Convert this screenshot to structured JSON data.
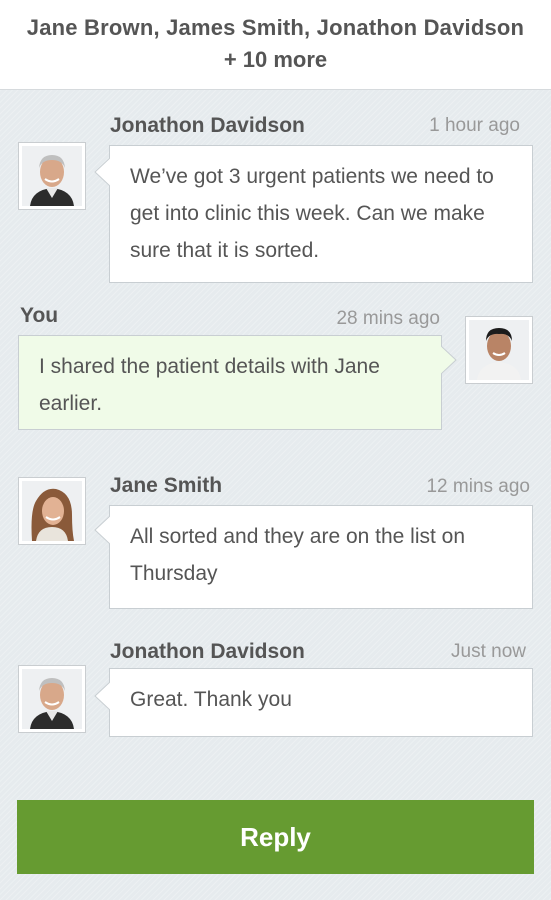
{
  "header": {
    "participants": "Jane Brown, James Smith, Jonathon Davidson",
    "more": "+ 10 more"
  },
  "messages": [
    {
      "sender": "Jonathon Davidson",
      "time": "1 hour ago",
      "text": "We’ve got 3 urgent patients we need to get into clinic this week.  Can we make sure that it is sorted.",
      "avatar": "older-man-avatar"
    },
    {
      "sender": "You",
      "time": "28 mins ago",
      "text": "I shared the patient details with Jane earlier.",
      "avatar": "young-man-avatar"
    },
    {
      "sender": "Jane Smith",
      "time": "12 mins ago",
      "text": "All sorted and they are on the list on Thursday",
      "avatar": "woman-avatar"
    },
    {
      "sender": "Jonathon Davidson",
      "time": "Just now",
      "text": "Great.  Thank you",
      "avatar": "older-man-avatar"
    }
  ],
  "reply_label": "Reply",
  "colors": {
    "accent_green": "#669b31",
    "own_bubble": "#f0fbe8",
    "background": "#e6ebee"
  }
}
